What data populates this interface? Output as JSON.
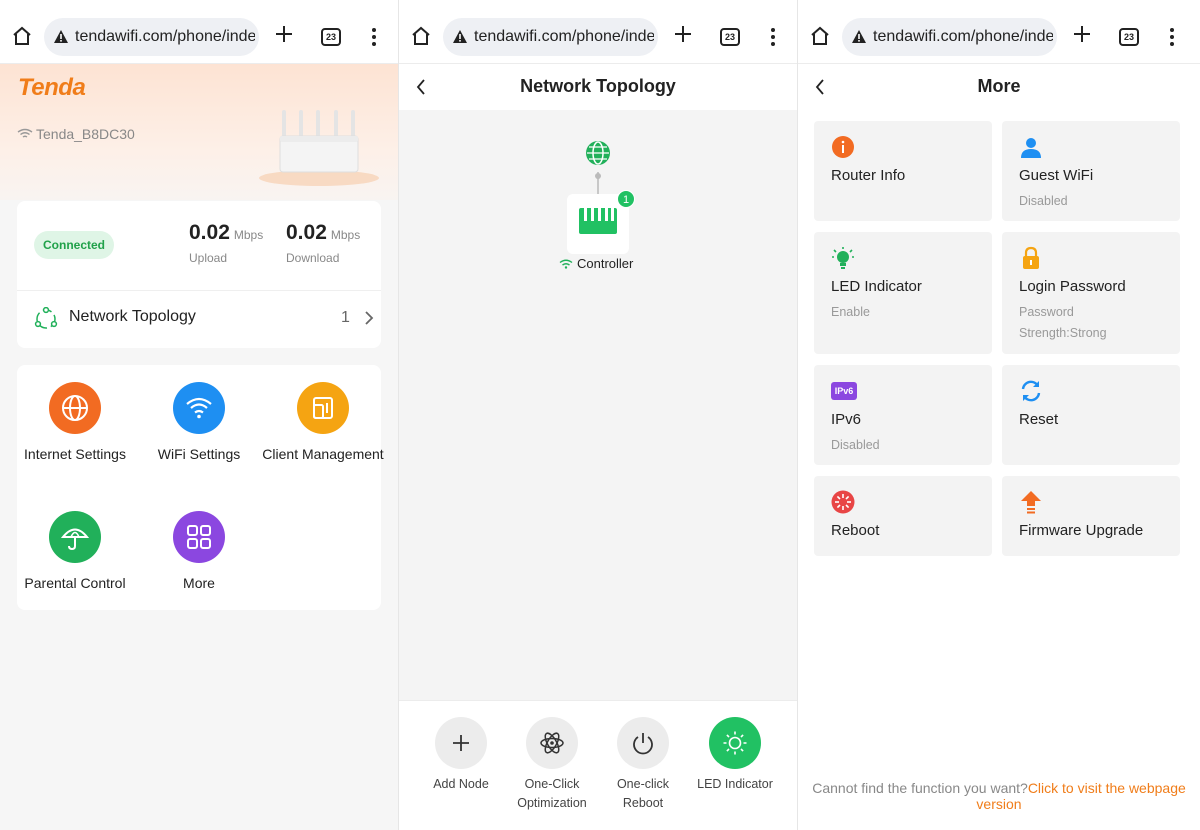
{
  "browser": {
    "url": "tendawifi.com/phone/inde:",
    "tab_count": "23"
  },
  "home": {
    "logo": "Tenda",
    "ssid": "Tenda_B8DC30",
    "status": "Connected",
    "upload": {
      "value": "0.02",
      "unit": "Mbps",
      "label": "Upload"
    },
    "download": {
      "value": "0.02",
      "unit": "Mbps",
      "label": "Download"
    },
    "topology": {
      "label": "Network Topology",
      "count": "1"
    },
    "functions": [
      {
        "label": "Internet Settings",
        "icon": "globe-icon",
        "color": "#f26b22"
      },
      {
        "label": "WiFi Settings",
        "icon": "wifi-icon",
        "color": "#1e8ff2"
      },
      {
        "label": "Client Management",
        "icon": "devices-icon",
        "color": "#f5a412"
      },
      {
        "label": "Parental Control",
        "icon": "umbrella-icon",
        "color": "#21b05a"
      },
      {
        "label": "More",
        "icon": "grid-icon",
        "color": "#8b47e0"
      }
    ]
  },
  "topology": {
    "title": "Network Topology",
    "node_label": "Controller",
    "node_badge": "1",
    "actions": [
      {
        "label": "Add Node",
        "icon": "plus-icon"
      },
      {
        "label": "One-Click Optimization",
        "icon": "atom-icon"
      },
      {
        "label": "One-click Reboot",
        "icon": "power-icon"
      },
      {
        "label": "LED Indicator",
        "icon": "sun-icon",
        "color": "#21c163"
      }
    ]
  },
  "more": {
    "title": "More",
    "tiles": [
      {
        "title": "Router Info",
        "sub": "",
        "icon": "info-icon"
      },
      {
        "title": "Guest WiFi",
        "sub": "Disabled",
        "icon": "guest-icon"
      },
      {
        "title": "LED Indicator",
        "sub": "Enable",
        "icon": "bulb-icon"
      },
      {
        "title": "Login Password",
        "sub": "Password",
        "sub2": "Strength:Strong",
        "icon": "lock-icon"
      },
      {
        "title": "IPv6",
        "sub": "Disabled",
        "icon": "ipv6-icon",
        "badge": "IPv6"
      },
      {
        "title": "Reset",
        "sub": "",
        "icon": "reset-icon"
      },
      {
        "title": "Reboot",
        "sub": "",
        "icon": "reboot-icon"
      },
      {
        "title": "Firmware Upgrade",
        "sub": "",
        "icon": "upgrade-icon"
      }
    ],
    "footer_text": "Cannot find the function you want?",
    "footer_link": "Click to visit the webpage version"
  }
}
